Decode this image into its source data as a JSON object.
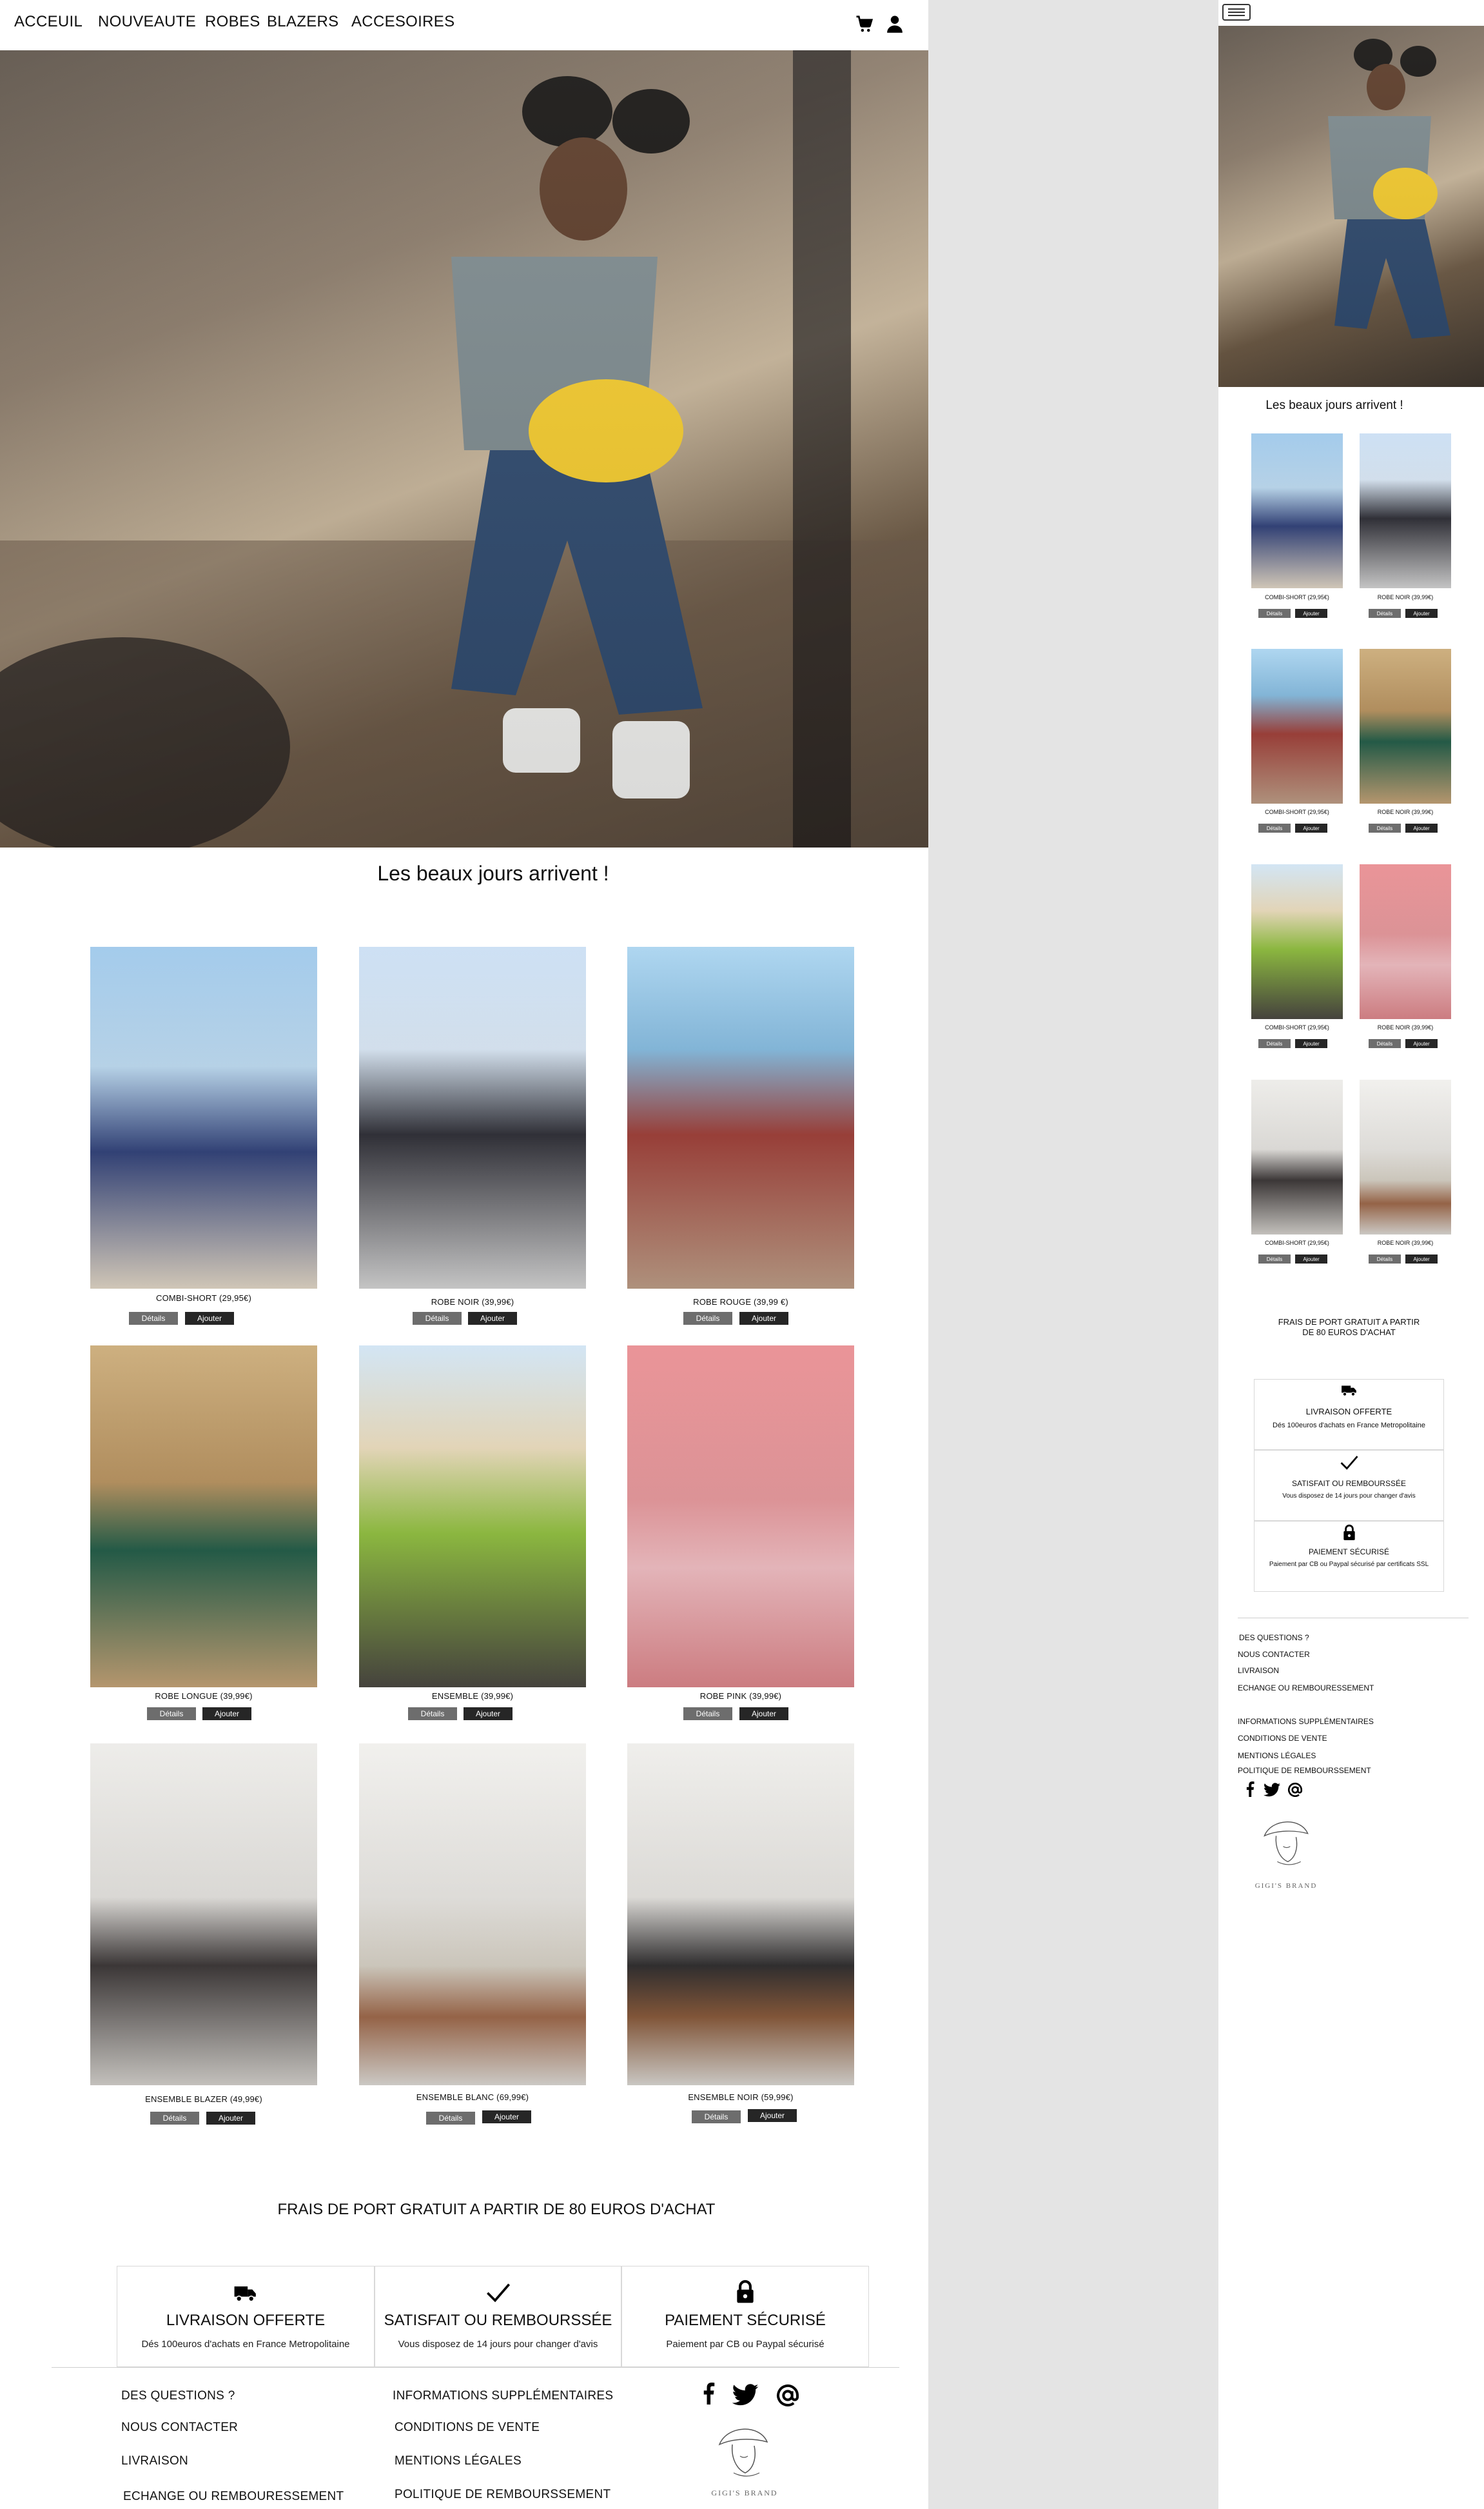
{
  "nav": {
    "items": [
      "ACCEUIL",
      "NOUVEAUTE",
      "ROBES",
      "BLAZERS",
      "ACCESOIRES"
    ],
    "cart_icon": "cart-icon",
    "user_icon": "user-icon"
  },
  "hero": {
    "image": "hero-model-photo"
  },
  "section_title": "Les beaux jours arrivent !",
  "buttons": {
    "details": "Détails",
    "add": "Ajouter"
  },
  "products": [
    {
      "label": "COMBI-SHORT (29,95€)",
      "image": "model-blue-top-beach"
    },
    {
      "label": "ROBE NOIR (39,99€)",
      "image": "model-black-hat"
    },
    {
      "label": "ROBE ROUGE (39,99 €)",
      "image": "model-red-dress"
    },
    {
      "label": "ROBE LONGUE (39,99€)",
      "image": "model-green-dress"
    },
    {
      "label": "ENSEMBLE (39,99€)",
      "image": "model-floral-set"
    },
    {
      "label": "ROBE PINK (39,99€)",
      "image": "model-pink-dress"
    },
    {
      "label": "ENSEMBLE BLAZER (49,99€)",
      "image": "model-black-blazer"
    },
    {
      "label": "ENSEMBLE BLANC (69,99€)",
      "image": "model-white-suit"
    },
    {
      "label": "ENSEMBLE NOIR (59,99€)",
      "image": "model-black-suit"
    }
  ],
  "shipping_banner": "FRAIS DE PORT GRATUIT A PARTIR DE 80 EUROS D'ACHAT",
  "features": [
    {
      "icon": "truck-icon",
      "title": "LIVRAISON OFFERTE",
      "text": "Dés 100euros d'achats en France Metropolitaine"
    },
    {
      "icon": "check-icon",
      "title": "SATISFAIT OU REMBOURSSÉE",
      "text": "Vous disposez de 14 jours pour changer d'avis"
    },
    {
      "icon": "lock-icon",
      "title": "PAIEMENT SÉCURISÉ",
      "text": "Paiement par CB ou Paypal  sécurisé"
    }
  ],
  "footer": {
    "col1": [
      "DES QUESTIONS ?",
      "NOUS CONTACTER",
      "LIVRAISON",
      "ECHANGE OU REMBOURESSEMENT"
    ],
    "col2": [
      "INFORMATIONS SUPPLÉMENTAIRES",
      "CONDITIONS DE VENTE",
      "MENTIONS LÉGALES",
      "POLITIQUE DE REMBOURSSEMENT"
    ],
    "social": [
      "facebook-icon",
      "twitter-icon",
      "at-icon"
    ],
    "brand": "GIGI'S BRAND"
  },
  "mobile": {
    "menu_icon": "menu-icon",
    "section_title": "Les beaux jours arrivent !",
    "products": [
      {
        "label": "COMBI-SHORT (29,95€)"
      },
      {
        "label": "ROBE NOIR (39,99€)"
      },
      {
        "label": "COMBI-SHORT (29,95€)"
      },
      {
        "label": "ROBE NOIR (39,99€)"
      },
      {
        "label": "COMBI-SHORT (29,95€)"
      },
      {
        "label": "ROBE NOIR (39,99€)"
      },
      {
        "label": "COMBI-SHORT (29,95€)"
      },
      {
        "label": "ROBE NOIR (39,99€)"
      }
    ],
    "shipping_banner_line1": "FRAIS DE PORT GRATUIT A PARTIR",
    "shipping_banner_line2": "DE 80 EUROS D'ACHAT",
    "features": [
      {
        "title": "LIVRAISON OFFERTE",
        "text": "Dés 100euros d'achats en France Metropolitaine"
      },
      {
        "title": "SATISFAIT OU REMBOURSSÉE",
        "text": "Vous disposez de 14 jours pour changer d'avis"
      },
      {
        "title": "PAIEMENT SÉCURISÉ",
        "text": "Paiement par CB ou Paypal sécurisé par certificats SSL"
      }
    ],
    "footer_col1": [
      "DES QUESTIONS ?",
      "NOUS CONTACTER",
      "LIVRAISON",
      "ECHANGE OU REMBOURESSEMENT"
    ],
    "footer_col2": [
      "INFORMATIONS SUPPLÉMENTAIRES",
      "CONDITIONS DE VENTE",
      "MENTIONS LÉGALES",
      "POLITIQUE DE REMBOURSSEMENT"
    ],
    "brand": "GIGI'S BRAND"
  }
}
